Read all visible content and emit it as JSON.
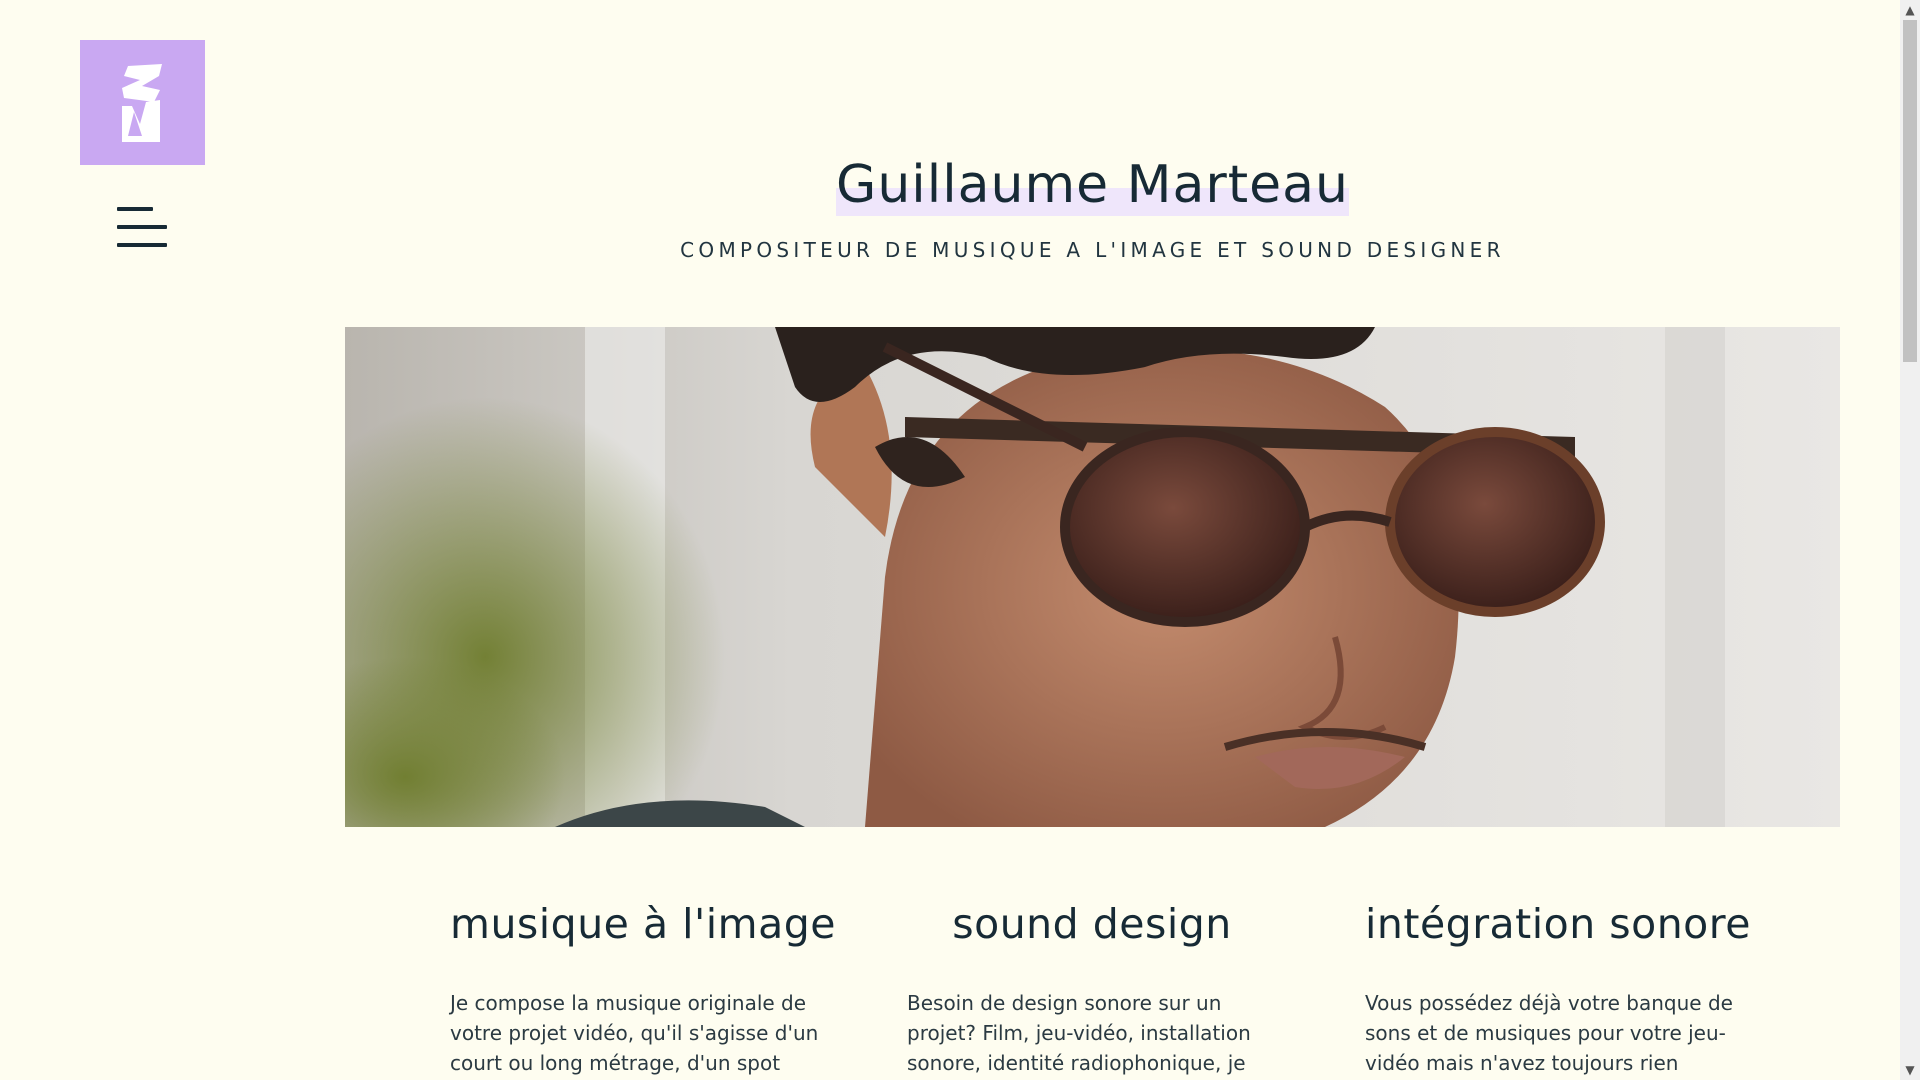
{
  "brand": {
    "logo_color": "#c9a8f2",
    "logo_icon": "sm-monogram-icon"
  },
  "nav": {
    "menu_icon": "hamburger-menu-icon"
  },
  "header": {
    "title": "Guillaume Marteau",
    "subtitle": "COMPOSITEUR DE MUSIQUE A L'IMAGE ET SOUND DESIGNER"
  },
  "hero": {
    "subject": "portrait-photo"
  },
  "services": [
    {
      "title": "musique à l'image",
      "text": "Je compose la musique originale de votre projet vidéo, qu'il s'agisse d'un court ou long métrage, d'un spot"
    },
    {
      "title": "sound design",
      "text": "Besoin de design sonore sur un projet? Film, jeu-vidéo, installation sonore, identité radiophonique, je"
    },
    {
      "title": "intégration sonore",
      "text": "Vous possédez déjà votre banque de sons et de musiques pour votre jeu-vidéo mais n'avez toujours rien"
    }
  ],
  "colors": {
    "background": "#fefdf0",
    "text": "#172a35",
    "accent": "#c9a8f2",
    "title_highlight": "#efe6fb"
  }
}
